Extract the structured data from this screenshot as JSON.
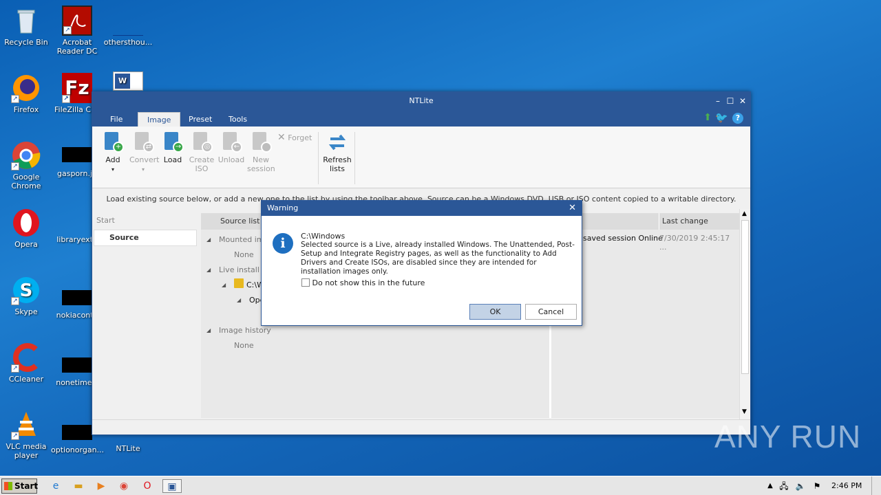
{
  "desktop": {
    "icons": [
      "Recycle Bin",
      "Acrobat Reader DC",
      "othersthou...",
      "Firefox",
      "FileZilla Clie",
      "Google Chrome",
      "gasporn.jp",
      "Opera",
      "libraryexte",
      "Skype",
      "nokiaconta",
      "CCleaner",
      "nonetimes.",
      "VLC media player",
      "optionorgan...",
      "NTLite"
    ]
  },
  "window": {
    "title": "NTLite",
    "menu": [
      "File",
      "Image",
      "Preset",
      "Tools"
    ],
    "ribbon": {
      "add": "Add",
      "convert": "Convert",
      "load": "Load",
      "create_iso": "Create ISO",
      "unload": "Unload",
      "new_session": "New session",
      "forget": "Forget",
      "refresh": "Refresh lists"
    },
    "hint": "Load existing source below, or add a new one to the list by using the toolbar above. Source can be a Windows DVD, USB or ISO content copied to a writable directory.",
    "start_label": "Start",
    "source_tab": "Source",
    "source_list_header": "Source list",
    "tree": {
      "mounted": "Mounted ima",
      "none1": "None",
      "live": "Live install",
      "cwin": "C:\\W",
      "ope": "Ope",
      "history": "Image history",
      "none2": "None"
    },
    "right": {
      "last_change_header": "Last change",
      "status": "saved session Online",
      "date": "7/30/2019 2:45:17 ..."
    }
  },
  "dialog": {
    "title": "Warning",
    "path": "C:\\Windows",
    "message": "Selected source is a Live, already installed Windows. The Unattended, Post-Setup and Integrate Registry pages, as well as the functionality to Add Drivers and Create ISOs, are disabled since they are intended for installation images only.",
    "checkbox": "Do not show this in the future",
    "ok": "OK",
    "cancel": "Cancel"
  },
  "taskbar": {
    "start": "Start",
    "clock": "2:46 PM"
  },
  "watermark": "ANY RUN"
}
